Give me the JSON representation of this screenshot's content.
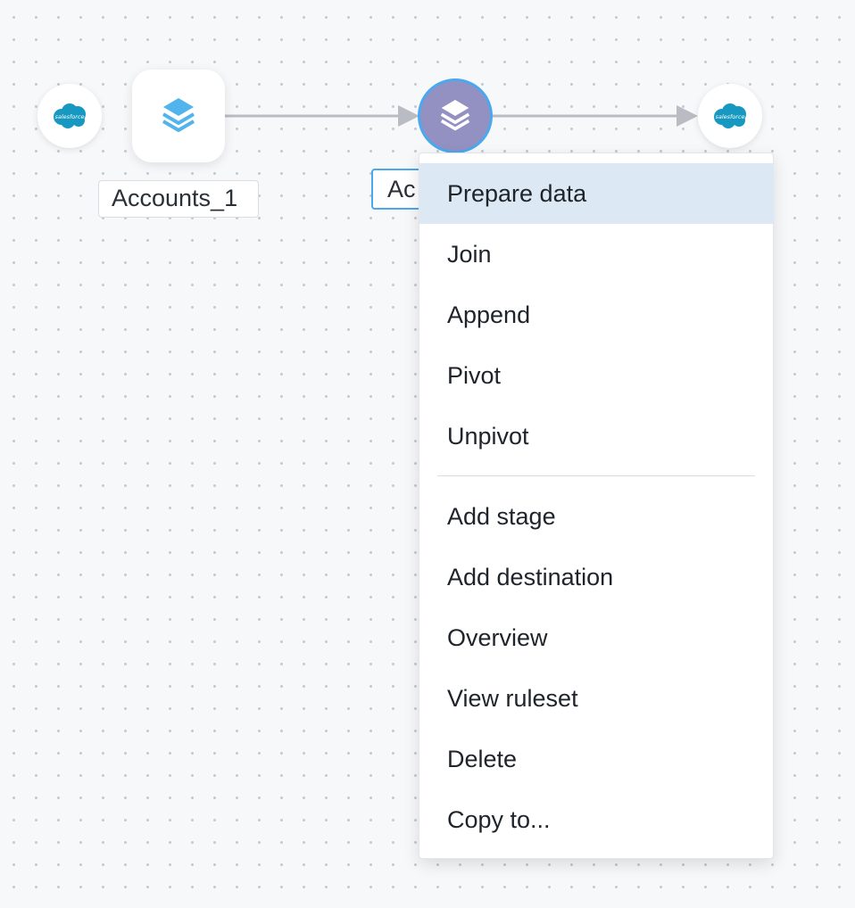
{
  "canvas": {
    "source_node": {
      "logo_text": "salesforce"
    },
    "dataset_node": {
      "label": "Accounts_1"
    },
    "stage_node": {
      "label": "Ac"
    },
    "destination_node": {
      "logo_text": "salesforce"
    }
  },
  "context_menu": {
    "group1": [
      {
        "label": "Prepare data",
        "active": true
      },
      {
        "label": "Join"
      },
      {
        "label": "Append"
      },
      {
        "label": "Pivot"
      },
      {
        "label": "Unpivot"
      }
    ],
    "group2": [
      {
        "label": "Add stage"
      },
      {
        "label": "Add destination"
      },
      {
        "label": "Overview"
      },
      {
        "label": "View ruleset"
      },
      {
        "label": "Delete"
      },
      {
        "label": "Copy to..."
      }
    ]
  },
  "colors": {
    "salesforce_blue": "#1798c1",
    "stage_purple": "#9391c2",
    "selection_blue": "#4aa8ee",
    "menu_highlight": "#dce9f5",
    "layers_icon_blue": "#52b4ec"
  },
  "icons": {
    "source": "salesforce-cloud-icon",
    "dataset": "layers-icon",
    "stage": "layers-icon",
    "destination": "salesforce-cloud-icon"
  }
}
